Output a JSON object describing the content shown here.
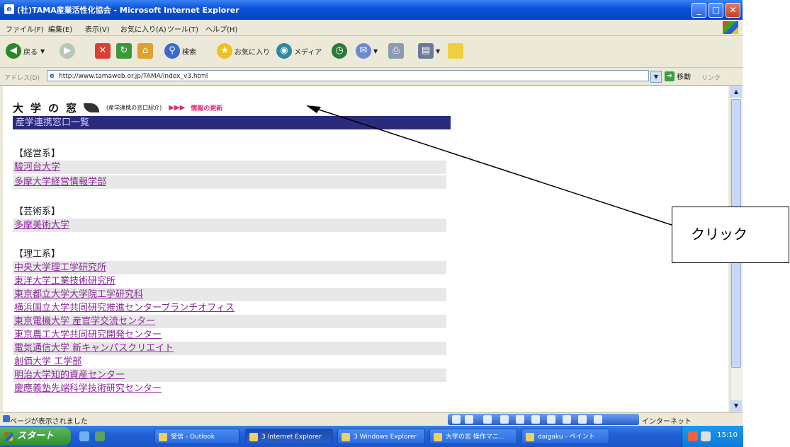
{
  "window": {
    "title": "(社)TAMA産業活性化協会 - Microsoft Internet Explorer",
    "controls": {
      "minimize": "_",
      "maximize": "□",
      "close": "✕"
    }
  },
  "menu": [
    "ファイル(F)",
    "編集(E)",
    "表示(V)",
    "お気に入り(A)",
    "ツール(T)",
    "ヘルプ(H)"
  ],
  "toolbar": {
    "back": "戻る",
    "search": "検索",
    "favorites": "お気に入り",
    "media": "メディア"
  },
  "address": {
    "label": "アドレス(D)",
    "url": "http://www.tamaweb.or.jp/TAMA/index_v3.html",
    "go": "移動",
    "links": "リンク"
  },
  "page": {
    "site_title": "大学の窓",
    "site_subtitle": "(産学連携の窓口紹介)",
    "arrows": "▶▶▶",
    "info_link": "情報の更新",
    "list_heading": "産学連携窓口一覧",
    "sections": [
      {
        "heading": "【経営系】",
        "items": [
          "駿河台大学",
          "多摩大学経営情報学部"
        ]
      },
      {
        "heading": "【芸術系】",
        "items": [
          "多摩美術大学"
        ]
      },
      {
        "heading": "【理工系】",
        "items": [
          "中央大学理工学研究所",
          "東洋大学工業技術研究所",
          "東京都立大学大学院工学研究科",
          "横浜国立大学共同研究推進センターブランチオフィス",
          "東京電機大学 産官学交流センター",
          "東京農工大学共同研究開発センター",
          "電気通信大学 新キャンパスクリエイト",
          "創価大学 工学部",
          "明治大学知的資産センター",
          "慶應義塾先端科学技術研究センター"
        ]
      }
    ]
  },
  "status": {
    "text": "ページが表示されました",
    "zone": "インターネット"
  },
  "taskbar": {
    "start": "スタート",
    "tasks": [
      "受信 - Outlook",
      "3 Internet Explorer",
      "3 Windows Explorer",
      "大学の窓 操作マニ...",
      "daigaku - ペイント"
    ],
    "clock": "15:10"
  },
  "annotation": {
    "callout": "クリック"
  }
}
